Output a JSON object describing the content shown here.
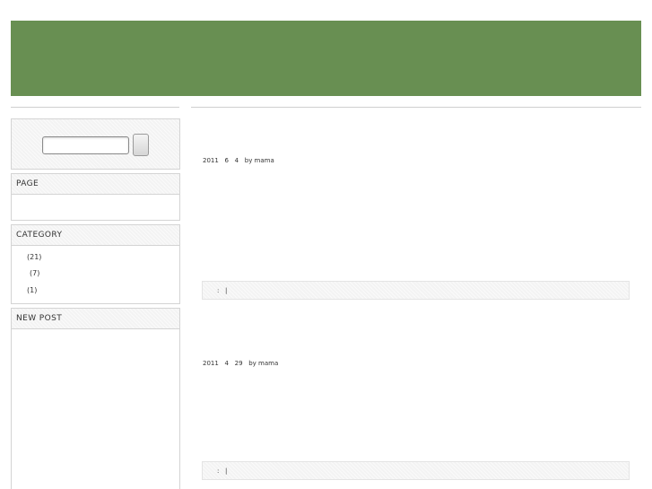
{
  "sidebar": {
    "page_widget": {
      "title": "PAGE"
    },
    "category_widget": {
      "title": "CATEGORY",
      "items": [
        "(21)",
        "(7)",
        "(1)"
      ]
    },
    "newpost_widget": {
      "title": "NEW POST"
    }
  },
  "posts": [
    {
      "meta": "2011   6   4   by mama",
      "footer": ":   |"
    },
    {
      "meta": "2011   4   29   by mama",
      "footer": ":   |"
    }
  ],
  "colors": {
    "banner": "#688f52",
    "widget_border": "#d4d4d4"
  }
}
